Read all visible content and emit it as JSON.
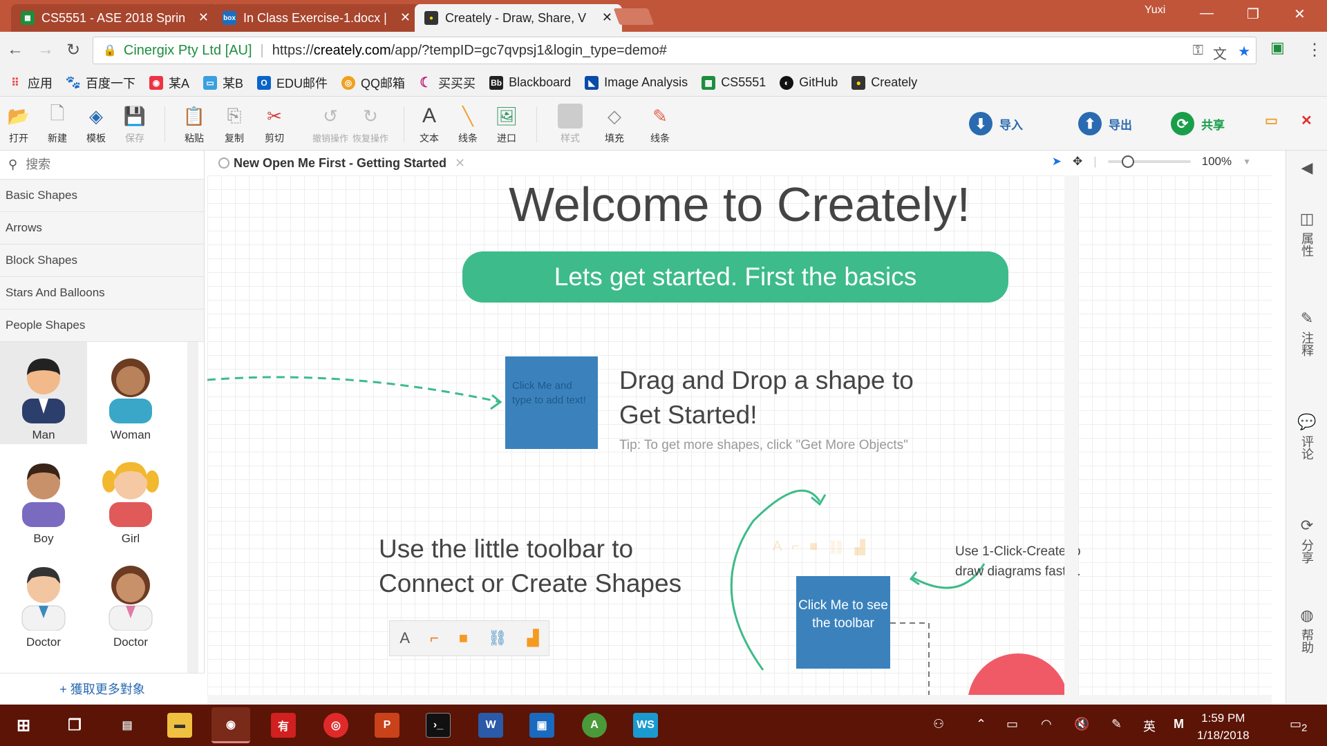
{
  "browser": {
    "tabs": [
      {
        "title": "CS5551 - ASE 2018 Sprin",
        "icon": "sheets-icon"
      },
      {
        "title": "In Class Exercise-1.docx |",
        "icon": "box-icon"
      },
      {
        "title": "Creately - Draw, Share, V",
        "icon": "creately-icon"
      }
    ],
    "profile": "Yuxi",
    "site_name": "Cinergix Pty Ltd [AU]",
    "url_scheme": "https://",
    "url_host": "creately.com",
    "url_path": "/app/?tempID=gc7qvpsj1&login_type=demo#"
  },
  "bookmarks": [
    "应用",
    "百度一下",
    "某A",
    "某B",
    "EDU邮件",
    "QQ邮箱",
    "买买买",
    "Blackboard",
    "Image Analysis",
    "CS5551",
    "GitHub",
    "Creately"
  ],
  "toolbar": {
    "file": [
      {
        "label": "打开",
        "icon": "folder-open-icon",
        "enabled": true
      },
      {
        "label": "新建",
        "icon": "new-doc-icon",
        "enabled": true
      },
      {
        "label": "模板",
        "icon": "templates-icon",
        "enabled": true
      },
      {
        "label": "保存",
        "icon": "save-icon",
        "enabled": false
      }
    ],
    "edit": [
      {
        "label": "粘贴",
        "icon": "paste-icon",
        "enabled": true
      },
      {
        "label": "复制",
        "icon": "copy-icon",
        "enabled": true
      },
      {
        "label": "剪切",
        "icon": "cut-icon",
        "enabled": true
      },
      {
        "label": "撤销操作",
        "icon": "undo-icon",
        "enabled": false
      },
      {
        "label": "恢复操作",
        "icon": "redo-icon",
        "enabled": false
      }
    ],
    "insert": [
      {
        "label": "文本",
        "icon": "text-icon",
        "enabled": true
      },
      {
        "label": "线条",
        "icon": "line-icon",
        "enabled": true
      },
      {
        "label": "进口",
        "icon": "image-icon",
        "enabled": true
      }
    ],
    "style": [
      {
        "label": "样式",
        "icon": "style-icon",
        "enabled": false
      },
      {
        "label": "填充",
        "icon": "fill-icon",
        "enabled": true
      },
      {
        "label": "线条",
        "icon": "pen-icon",
        "enabled": true
      }
    ],
    "import_label": "导入",
    "export_label": "导出",
    "share_label": "共享"
  },
  "left_panel": {
    "search_placeholder": "搜索",
    "categories": [
      "Basic Shapes",
      "Arrows",
      "Block Shapes",
      "Stars And Balloons",
      "People Shapes"
    ],
    "shapes": [
      "Man",
      "Woman",
      "Boy",
      "Girl",
      "Doctor",
      "Doctor"
    ],
    "more_objects": "+ 獲取更多對象"
  },
  "document": {
    "tab_title": "New Open Me First - Getting Started",
    "zoom": "100%"
  },
  "canvas": {
    "welcome": "Welcome to Creately!",
    "banner": "Lets get started. First the basics",
    "box1_text": "Click Me and type to add text!",
    "drag_line1": "Drag and Drop a shape to",
    "drag_line2": "Get Started!",
    "drag_tip": "Tip: To get more shapes, click  \"Get More Objects\"",
    "toolbar_line1": "Use the little toolbar to",
    "toolbar_line2": "Connect or Create Shapes",
    "box2_text": "Click Me to see the toolbar",
    "one_click_line1": "Use 1-Click-Create to",
    "one_click_line2": "draw diagrams faster."
  },
  "right_rail": [
    "属性",
    "注释",
    "评论",
    "分享",
    "帮助"
  ],
  "taskbar": {
    "time": "1:59 PM",
    "date": "1/18/2018",
    "ime": "英",
    "notifications": "2"
  },
  "colors": {
    "tabstrip": "#c0553a",
    "banner": "#3dbb8a",
    "shape_blue": "#3b82bd",
    "accent_red": "#f05a66",
    "taskbar": "#5b1406"
  }
}
